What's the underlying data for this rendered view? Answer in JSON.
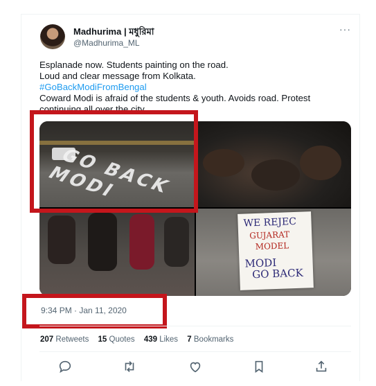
{
  "tweet": {
    "display_name": "Madhurima | মধুরিমা",
    "handle": "@Madhurima_ML",
    "more_icon": "more-icon",
    "text_line1": "Esplanade now. Students painting on the road.",
    "text_line2": "Loud and clear message from Kolkata.",
    "hashtag": "#GoBackModiFromBengal",
    "text_line3": "Coward Modi is afraid of the students & youth. Avoids road. Protest",
    "text_line4": "continuing all over the city",
    "timestamp": "9:34 PM · Jan 11, 2020",
    "stats": [
      {
        "count": "207",
        "label": "Retweets"
      },
      {
        "count": "15",
        "label": "Quotes"
      },
      {
        "count": "439",
        "label": "Likes"
      },
      {
        "count": "7",
        "label": "Bookmarks"
      }
    ],
    "media": {
      "photo1_road_text": "GO BACK MODI",
      "sign_lines": [
        "WE REJEC",
        "GUJARAT",
        "MODEL",
        "MODI",
        "GO BACK"
      ]
    },
    "actions": [
      "reply-icon",
      "retweet-icon",
      "like-icon",
      "bookmark-icon",
      "share-icon"
    ]
  },
  "colors": {
    "text": "#0f1419",
    "secondary": "#536471",
    "link": "#1d9bf0",
    "highlight_box": "#c4161c"
  }
}
